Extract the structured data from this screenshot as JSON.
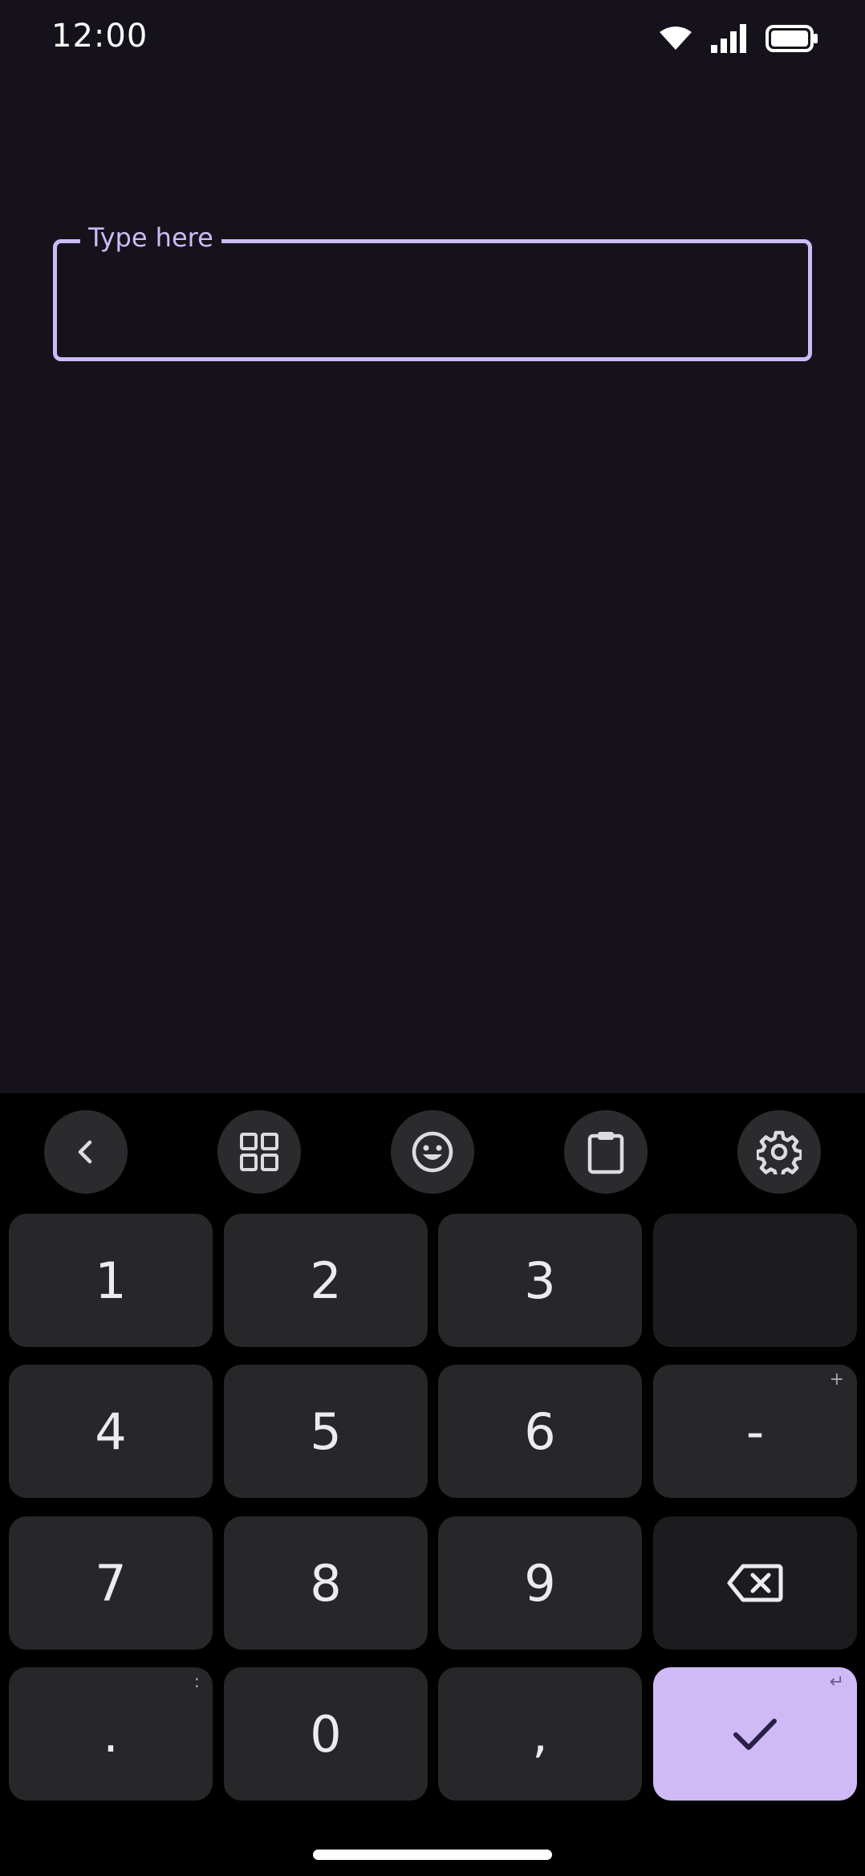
{
  "status_bar": {
    "time": "12:00",
    "icons": [
      "wifi-icon",
      "cellular-signal-icon",
      "battery-icon"
    ]
  },
  "text_field": {
    "label": "Type here",
    "value": "",
    "accent_color": "#cdbaf6"
  },
  "keyboard": {
    "toolbar": [
      "back-arrow-icon",
      "grid-icon",
      "emoji-icon",
      "clipboard-icon",
      "gear-icon"
    ],
    "keys": {
      "k1": "1",
      "k2": "2",
      "k3": "3",
      "k4": "4",
      "k5": "5",
      "k6": "6",
      "minus": "-",
      "minus_hint": "+",
      "k7": "7",
      "k8": "8",
      "k9": "9",
      "period": ".",
      "period_hint": ":",
      "k0": "0",
      "comma": ",",
      "enter_hint": "↵"
    },
    "confirm_color": "#cfbaf7"
  }
}
